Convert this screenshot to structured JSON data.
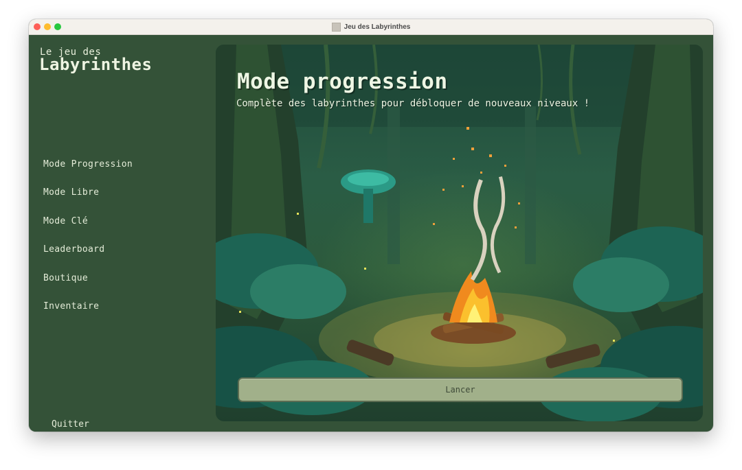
{
  "window": {
    "title": "Jeu des Labyrinthes"
  },
  "sidebar": {
    "logo_line1": "Le jeu des",
    "logo_line2": "Labyrinthes",
    "items": [
      {
        "label": "Mode Progression"
      },
      {
        "label": "Mode Libre"
      },
      {
        "label": "Mode Clé"
      },
      {
        "label": "Leaderboard"
      },
      {
        "label": "Boutique"
      },
      {
        "label": "Inventaire"
      }
    ],
    "quit_label": "Quitter"
  },
  "main": {
    "title": "Mode progression",
    "subtitle": "Complète des labyrinthes pour débloquer de nouveaux niveaux !",
    "launch_label": "Lancer"
  },
  "colors": {
    "sidebar_bg": "#345238",
    "button_bg": "#a1b08a",
    "text_light": "#eef6e4"
  },
  "icons": [
    "close-icon",
    "minimize-icon",
    "maximize-icon",
    "document-icon"
  ]
}
